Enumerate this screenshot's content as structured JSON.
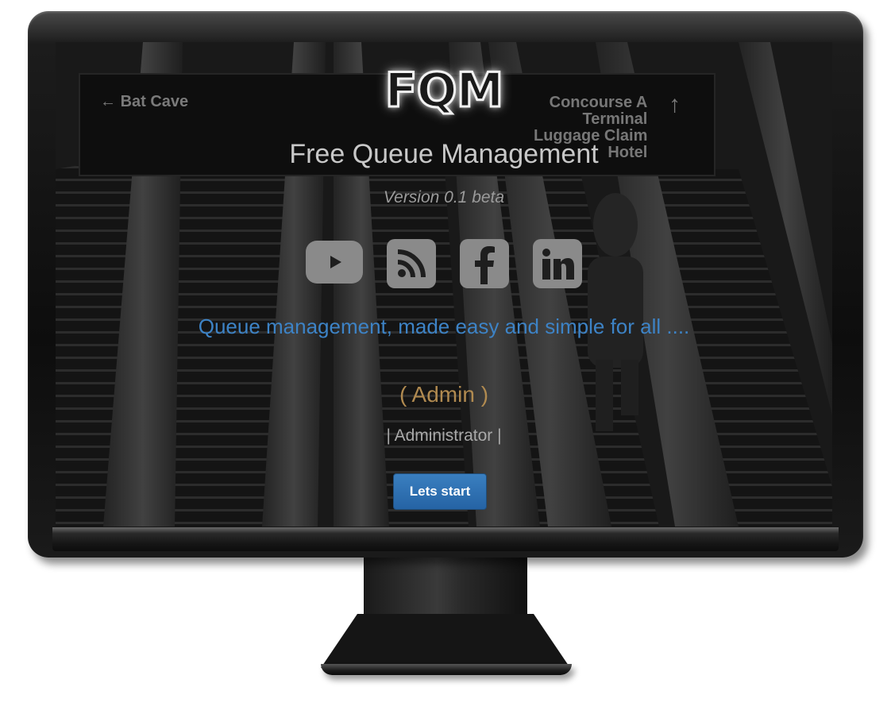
{
  "logo": {
    "text": "FQM"
  },
  "title": "Free Queue Management",
  "version": "Version 0.1 beta",
  "social": [
    {
      "name": "youtube",
      "icon": "youtube-icon"
    },
    {
      "name": "rss",
      "icon": "rss-icon"
    },
    {
      "name": "facebook",
      "icon": "facebook-icon"
    },
    {
      "name": "linkedin",
      "icon": "linkedin-icon"
    }
  ],
  "tagline": "Queue management, made easy and simple for all ....",
  "user": {
    "name": "( Admin )",
    "role": "| Administrator |"
  },
  "start_button": {
    "label": "Lets start"
  },
  "background_sign": {
    "left": "Bat Cave",
    "right": [
      "Concourse A",
      "Terminal",
      "Luggage Claim",
      "Hotel"
    ]
  },
  "colors": {
    "tagline": "#3d83c6",
    "admin_name": "#b08a50",
    "button": "#2f71b3",
    "icons": "#8a8a8a"
  }
}
